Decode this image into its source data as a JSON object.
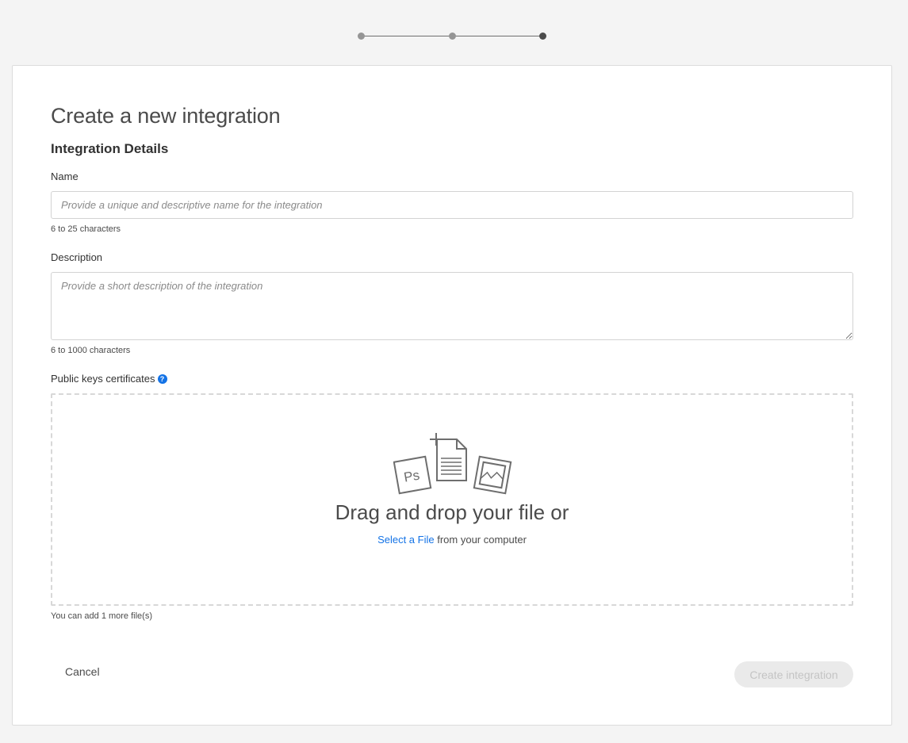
{
  "stepper": {
    "total_steps": 3,
    "current_step": 3
  },
  "form": {
    "title": "Create a new integration",
    "subtitle": "Integration Details",
    "name": {
      "label": "Name",
      "placeholder": "Provide a unique and descriptive name for the integration",
      "value": "",
      "hint": "6 to 25 characters"
    },
    "description": {
      "label": "Description",
      "placeholder": "Provide a short description of the integration",
      "value": "",
      "hint": "6 to 1000 characters"
    },
    "certificates": {
      "label": "Public keys certificates",
      "help_icon": "question-circle-icon",
      "drop_title": "Drag and drop your file or",
      "select_link": "Select a File",
      "select_suffix": " from your computer",
      "hint": "You can add 1 more file(s)"
    }
  },
  "actions": {
    "cancel_label": "Cancel",
    "create_label": "Create integration",
    "create_disabled": true
  },
  "colors": {
    "accent": "#1473e6",
    "background": "#f4f4f4",
    "card": "#ffffff"
  }
}
